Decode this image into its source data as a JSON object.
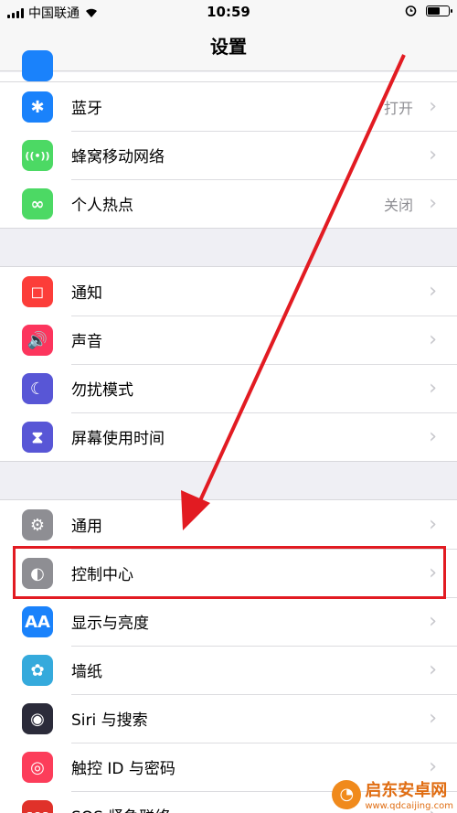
{
  "status_bar": {
    "carrier": "中国联通",
    "time": "10:59",
    "wifi_icon": "wifi-icon",
    "alarm_icon": "alarm-icon",
    "battery_level": 0.6
  },
  "nav": {
    "title": "设置"
  },
  "groups": [
    {
      "items": [
        {
          "label": "蓝牙",
          "value": "打开",
          "icon": "bluetooth-icon",
          "color": "#1a82fb",
          "glyph": "✱"
        },
        {
          "label": "蜂窝移动网络",
          "value": "",
          "icon": "cellular-icon",
          "color": "#4cd964",
          "glyph": "((•))"
        },
        {
          "label": "个人热点",
          "value": "关闭",
          "icon": "hotspot-icon",
          "color": "#4cd964",
          "glyph": "∞"
        }
      ]
    },
    {
      "items": [
        {
          "label": "通知",
          "icon": "notifications-icon",
          "color": "#fc3d39",
          "glyph": "◻"
        },
        {
          "label": "声音",
          "icon": "sounds-icon",
          "color": "#fc355d",
          "glyph": "🔊"
        },
        {
          "label": "勿扰模式",
          "icon": "moon-icon",
          "color": "#5856d6",
          "glyph": "☾"
        },
        {
          "label": "屏幕使用时间",
          "icon": "hourglass-icon",
          "color": "#5856d6",
          "glyph": "⧗"
        }
      ]
    },
    {
      "items": [
        {
          "label": "通用",
          "icon": "gear-icon",
          "color": "#8e8e93",
          "glyph": "⚙"
        },
        {
          "label": "控制中心",
          "icon": "toggles-icon",
          "color": "#8e8e93",
          "glyph": "◐"
        },
        {
          "label": "显示与亮度",
          "icon": "display-icon",
          "color": "#1a82fb",
          "glyph": "AA"
        },
        {
          "label": "墙纸",
          "icon": "wallpaper-icon",
          "color": "#35aadc",
          "glyph": "✿"
        },
        {
          "label": "Siri 与搜索",
          "icon": "siri-icon",
          "color": "#2b2b3a",
          "glyph": "◉"
        },
        {
          "label": "触控 ID 与密码",
          "icon": "fingerprint-icon",
          "color": "#fc3d5a",
          "glyph": "◎"
        },
        {
          "label": "SOS 紧急联络",
          "icon": "sos-icon",
          "color": "#e0312a",
          "glyph": "SOS"
        }
      ]
    }
  ],
  "chevron": "›",
  "watermark": {
    "name": "启东安卓网",
    "url": "www.qdcaijing.com",
    "logo_icon": "qidong-logo-icon"
  }
}
